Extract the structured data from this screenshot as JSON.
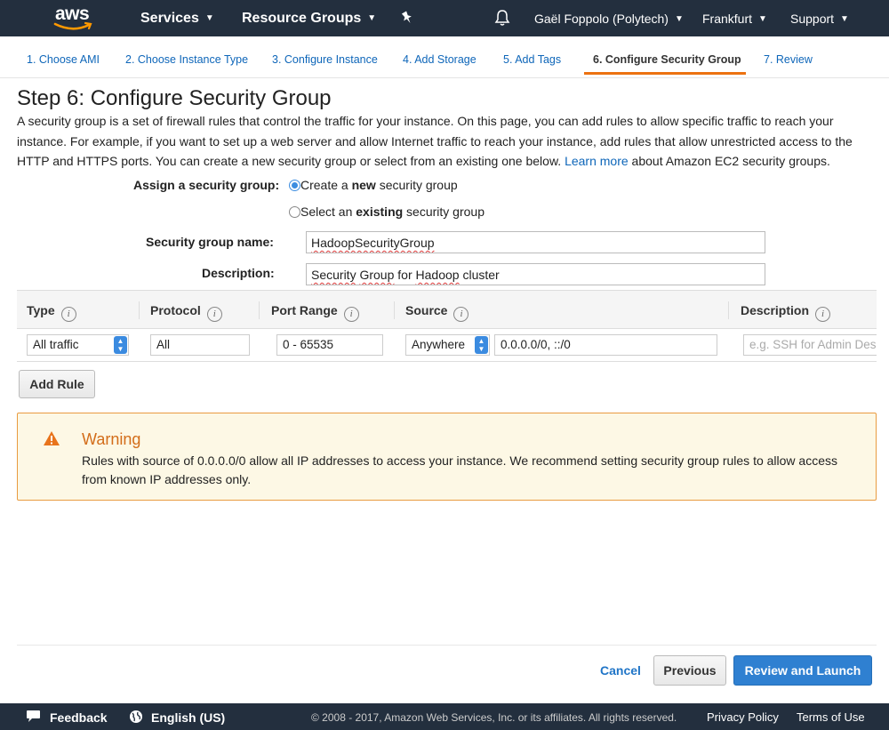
{
  "nav": {
    "logo": "aws",
    "services": "Services",
    "resource_groups": "Resource Groups",
    "user": "Gaël Foppolo (Polytech)",
    "region": "Frankfurt",
    "support": "Support"
  },
  "steps": [
    {
      "label": "1. Choose AMI"
    },
    {
      "label": "2. Choose Instance Type"
    },
    {
      "label": "3. Configure Instance"
    },
    {
      "label": "4. Add Storage"
    },
    {
      "label": "5. Add Tags"
    },
    {
      "label": "6. Configure Security Group",
      "active": true
    },
    {
      "label": "7. Review"
    }
  ],
  "page": {
    "title": "Step 6: Configure Security Group",
    "intro": "A security group is a set of firewall rules that control the traffic for your instance. On this page, you can add rules to allow specific traffic to reach your instance. For example, if you want to set up a web server and allow Internet traffic to reach your instance, add rules that allow unrestricted access to the HTTP and HTTPS ports. You can create a new security group or select from an existing one below.",
    "learn_more": "Learn more",
    "intro_tail": "about Amazon EC2 security groups."
  },
  "form": {
    "assign_label": "Assign a security group:",
    "option_new_pre": "Create a ",
    "option_new_bold": "new",
    "option_new_post": " security group",
    "option_existing_pre": "Select an ",
    "option_existing_bold": "existing",
    "option_existing_post": " security group",
    "name_label": "Security group name:",
    "name_value": "HadoopSecurityGroup",
    "desc_label": "Description:",
    "desc_value_w1": "Security",
    "desc_value_w2": "Group",
    "desc_value_w3": "for",
    "desc_value_w4": "Hadoop",
    "desc_value_w5": "cluster"
  },
  "table": {
    "headers": [
      "Type",
      "Protocol",
      "Port Range",
      "Source",
      "Description"
    ],
    "row": {
      "type": "All traffic",
      "protocol": "All",
      "port_range": "0 - 65535",
      "source_select": "Anywhere",
      "source_cidr": "0.0.0.0/0, ::/0",
      "description_placeholder": "e.g. SSH for Admin Desktop"
    },
    "add_rule": "Add Rule"
  },
  "warning": {
    "title": "Warning",
    "body": "Rules with source of 0.0.0.0/0 allow all IP addresses to access your instance. We recommend setting security group rules to allow access from known IP addresses only."
  },
  "actions": {
    "cancel": "Cancel",
    "previous": "Previous",
    "review_launch": "Review and Launch"
  },
  "footer": {
    "feedback": "Feedback",
    "language": "English (US)",
    "copyright": "© 2008 - 2017, Amazon Web Services, Inc. or its affiliates. All rights reserved.",
    "privacy": "Privacy Policy",
    "terms": "Terms of Use"
  },
  "colors": {
    "nav_bg": "#232f3e",
    "link": "#0e66b9",
    "accent_orange": "#ec7211",
    "primary_button": "#2f80d1",
    "warning_border": "#e99b40",
    "warning_bg": "#fdf8e5"
  }
}
